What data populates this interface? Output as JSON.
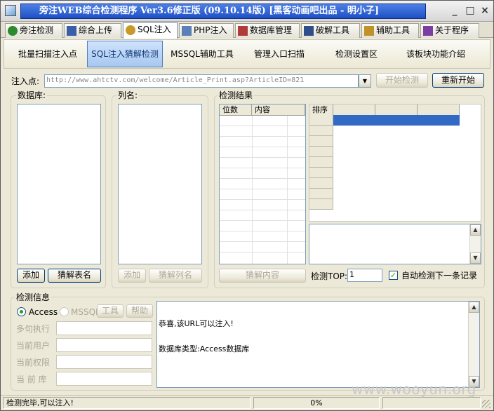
{
  "window": {
    "title": "旁注WEB综合检测程序 Ver3.6修正版 (09.10.14版) [黑客动画吧出品 - 明小子]",
    "minimize": "_",
    "restore": "□",
    "close": "×"
  },
  "tabs": [
    {
      "label": "旁注检测",
      "icon": "globe-icon",
      "color": "#2d8a2d"
    },
    {
      "label": "综合上传",
      "icon": "chart-icon",
      "color": "#3a5fa8"
    },
    {
      "label": "SQL注入",
      "icon": "magnifier-icon",
      "color": "#c89a2a"
    },
    {
      "label": "PHP注入",
      "icon": "page-icon",
      "color": "#5b7fb7"
    },
    {
      "label": "数据库管理",
      "icon": "database-icon",
      "color": "#b23a3a"
    },
    {
      "label": "破解工具",
      "icon": "keyboard-icon",
      "color": "#2f4f8a"
    },
    {
      "label": "辅助工具",
      "icon": "clipboard-icon",
      "color": "#c0922a"
    },
    {
      "label": "关于程序",
      "icon": "books-icon",
      "color": "#7a3fa0"
    }
  ],
  "subtabs": [
    "批量扫描注入点",
    "SQL注入猜解检测",
    "MSSQL辅助工具",
    "管理入口扫描",
    "检测设置区",
    "该板块功能介绍"
  ],
  "inject": {
    "label": "注入点:",
    "url": "http://www.ahtctv.com/welcome/Article_Print.asp?ArticleID=821",
    "start_label": "开始检测",
    "restart_label": "重新开始"
  },
  "database": {
    "title": "数据库:",
    "add_label": "添加",
    "guess_label": "猜解表名"
  },
  "columns": {
    "title": "列名:",
    "add_label": "添加",
    "guess_label": "猜解列名"
  },
  "results": {
    "title": "检测结果",
    "col_pos": "位数",
    "col_content": "内容",
    "sort_header": "排序",
    "guess_content_label": "猜解内容",
    "top_label": "检测TOP:",
    "top_value": "1",
    "auto_next_label": "自动检测下一条记录",
    "auto_next_checked": "✓"
  },
  "info": {
    "title": "检测信息",
    "access_label": "Access",
    "mssql_label": "MSSQL",
    "tool_btn1": "工具",
    "tool_btn2": "帮助",
    "multi_exec_label": "多句执行",
    "user_label": "当前用户",
    "perm_label": "当前权限",
    "db_label": "当 前 库",
    "log_line1": "恭喜,该URL可以注入!",
    "log_line2": "数据库类型:Access数据库"
  },
  "status": {
    "text": "检测完毕,可以注入!",
    "progress": "0%"
  },
  "watermark": "www.wooyun.org",
  "colors": {
    "title_bar": "#1d4fc4",
    "selection": "#316ac5",
    "window_bg": "#ece9d8"
  }
}
